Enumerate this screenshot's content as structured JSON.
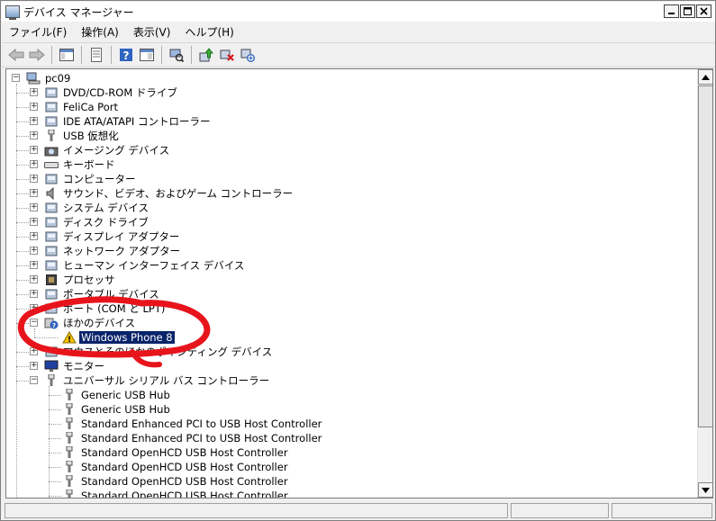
{
  "window": {
    "title": "デバイス マネージャー"
  },
  "menu": [
    "ファイル(F)",
    "操作(A)",
    "表示(V)",
    "ヘルプ(H)"
  ],
  "toolbar": {
    "icons": [
      "back-arrow-icon",
      "forward-arrow-icon",
      "show-hide-console-tree-icon",
      "properties-icon",
      "help-icon",
      "view-icon",
      "scan-hardware-icon",
      "update-driver-icon",
      "uninstall-icon",
      "disable-icon"
    ]
  },
  "tree": {
    "root": "pc09",
    "categories": [
      {
        "label": "DVD/CD-ROM ドライブ",
        "icon": "dvd-drive-icon"
      },
      {
        "label": "FeliCa Port",
        "icon": "felica-icon"
      },
      {
        "label": "IDE ATA/ATAPI コントローラー",
        "icon": "ide-controller-icon"
      },
      {
        "label": "USB 仮想化",
        "icon": "usb-icon"
      },
      {
        "label": "イメージング デバイス",
        "icon": "camera-icon"
      },
      {
        "label": "キーボード",
        "icon": "keyboard-icon"
      },
      {
        "label": "コンピューター",
        "icon": "computer-icon"
      },
      {
        "label": "サウンド、ビデオ、およびゲーム コントローラー",
        "icon": "speaker-icon"
      },
      {
        "label": "システム デバイス",
        "icon": "system-device-icon"
      },
      {
        "label": "ディスク ドライブ",
        "icon": "disk-drive-icon"
      },
      {
        "label": "ディスプレイ アダプター",
        "icon": "display-adapter-icon"
      },
      {
        "label": "ネットワーク アダプター",
        "icon": "network-adapter-icon"
      },
      {
        "label": "ヒューマン インターフェイス デバイス",
        "icon": "hid-icon"
      },
      {
        "label": "プロセッサ",
        "icon": "processor-icon"
      },
      {
        "label": "ポータブル デバイス",
        "icon": "portable-device-icon"
      },
      {
        "label": "ポート (COM と LPT)",
        "icon": "port-icon"
      }
    ],
    "other_devices": {
      "label": "ほかのデバイス",
      "child": "Windows Phone 8"
    },
    "after": [
      {
        "label": "マウスとそのほかのポインティング デバイス",
        "icon": "mouse-icon"
      },
      {
        "label": "モニター",
        "icon": "monitor-icon"
      }
    ],
    "usb_controllers": {
      "label": "ユニバーサル シリアル バス コントローラー",
      "children": [
        "Generic USB Hub",
        "Generic USB Hub",
        "Standard Enhanced PCI to USB Host Controller",
        "Standard Enhanced PCI to USB Host Controller",
        "Standard OpenHCD USB Host Controller",
        "Standard OpenHCD USB Host Controller",
        "Standard OpenHCD USB Host Controller",
        "Standard OpenHCD USB Host Controller"
      ]
    }
  },
  "colors": {
    "selection": "#0a246a",
    "annotation": "#e8141c",
    "warning": "#f5c400"
  }
}
